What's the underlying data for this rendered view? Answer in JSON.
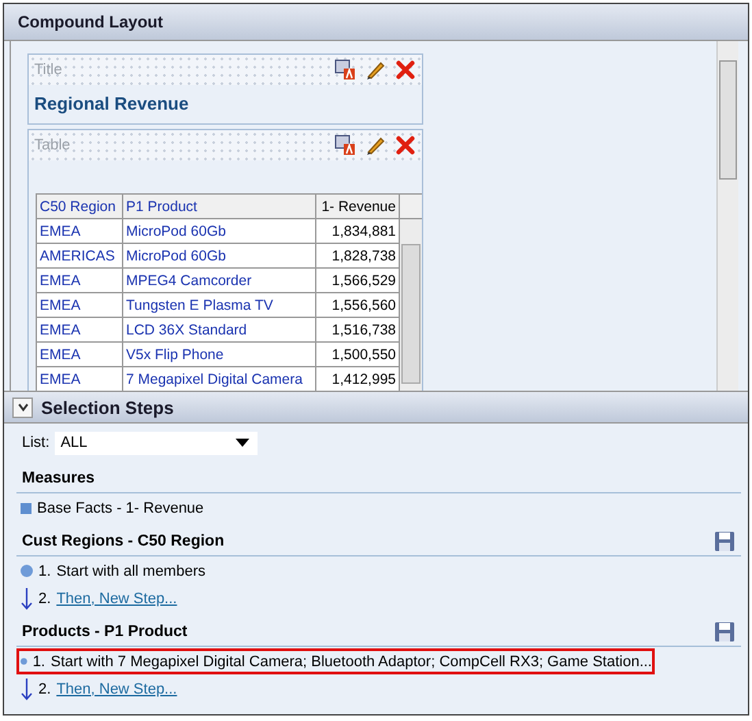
{
  "compound_layout": {
    "title": "Compound Layout",
    "views": [
      {
        "label": "Title",
        "kind": "title",
        "text": "Regional Revenue"
      },
      {
        "label": "Table",
        "kind": "table",
        "table": {
          "columns": [
            "C50 Region",
            "P1 Product",
            "1- Revenue"
          ],
          "rows": [
            [
              "EMEA",
              "MicroPod 60Gb",
              "1,834,881"
            ],
            [
              "AMERICAS",
              "MicroPod 60Gb",
              "1,828,738"
            ],
            [
              "EMEA",
              "MPEG4 Camcorder",
              "1,566,529"
            ],
            [
              "EMEA",
              "Tungsten E Plasma TV",
              "1,556,560"
            ],
            [
              "EMEA",
              "LCD 36X Standard",
              "1,516,738"
            ],
            [
              "EMEA",
              "V5x Flip Phone",
              "1,500,550"
            ],
            [
              "EMEA",
              "7 Megapixel Digital Camera",
              "1,412,995"
            ]
          ]
        }
      }
    ]
  },
  "selection_steps": {
    "title": "Selection Steps",
    "expanded": true,
    "list_label": "List:",
    "list_value": "ALL",
    "sections": [
      {
        "heading": "Measures",
        "savable": false,
        "steps": [
          {
            "kind": "measure",
            "text": "Base Facts - 1- Revenue",
            "highlighted": false
          }
        ]
      },
      {
        "heading": "Cust Regions - C50 Region",
        "savable": true,
        "steps": [
          {
            "kind": "start",
            "number": "1.",
            "text": "Start with all members",
            "highlighted": false
          },
          {
            "kind": "new",
            "number": "2.",
            "text": "Then, New Step...",
            "highlighted": false
          }
        ]
      },
      {
        "heading": "Products - P1 Product",
        "savable": true,
        "steps": [
          {
            "kind": "start",
            "number": "1.",
            "text": "Start with 7 Megapixel Digital Camera; Bluetooth Adaptor; CompCell RX3; Game Station...",
            "highlighted": true
          },
          {
            "kind": "new",
            "number": "2.",
            "text": "Then, New Step...",
            "highlighted": false
          }
        ]
      }
    ]
  }
}
